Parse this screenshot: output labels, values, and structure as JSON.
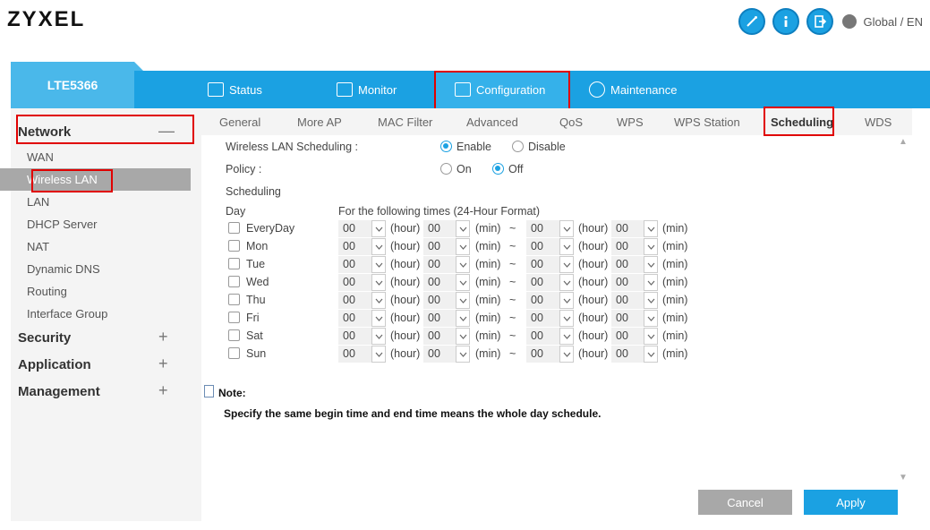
{
  "brand": "ZYXEL",
  "header": {
    "icons": [
      "wizard-icon",
      "info-icon",
      "logout-icon"
    ],
    "language": "Global / EN"
  },
  "device": "LTE5366",
  "nav": [
    {
      "label": "Status",
      "icon": "status-icon"
    },
    {
      "label": "Monitor",
      "icon": "monitor-icon"
    },
    {
      "label": "Configuration",
      "icon": "configuration-icon"
    },
    {
      "label": "Maintenance",
      "icon": "gear-icon"
    }
  ],
  "sidebar": {
    "network": {
      "label": "Network",
      "toggle": "—",
      "items": [
        "WAN",
        "Wireless LAN",
        "LAN",
        "DHCP Server",
        "NAT",
        "Dynamic DNS",
        "Routing",
        "Interface Group"
      ]
    },
    "groups": [
      {
        "label": "Security",
        "toggle": "+"
      },
      {
        "label": "Application",
        "toggle": "+"
      },
      {
        "label": "Management",
        "toggle": "+"
      }
    ]
  },
  "tabs": [
    "General",
    "More AP",
    "MAC Filter",
    "Advanced",
    "QoS",
    "WPS",
    "WPS Station",
    "Scheduling",
    "WDS"
  ],
  "form": {
    "wlan_scheduling_label": "Wireless LAN Scheduling :",
    "enable": "Enable",
    "disable": "Disable",
    "policy_label": "Policy :",
    "on": "On",
    "off": "Off",
    "scheduling_label": "Scheduling",
    "day_header": "Day",
    "times_header": "For the following times (24-Hour Format)",
    "hour_unit": "(hour)",
    "min_unit": "(min)",
    "tilde": "~",
    "rows": [
      {
        "day": "EveryDay",
        "v": [
          "00",
          "00",
          "00",
          "00"
        ]
      },
      {
        "day": "Mon",
        "v": [
          "00",
          "00",
          "00",
          "00"
        ]
      },
      {
        "day": "Tue",
        "v": [
          "00",
          "00",
          "00",
          "00"
        ]
      },
      {
        "day": "Wed",
        "v": [
          "00",
          "00",
          "00",
          "00"
        ]
      },
      {
        "day": "Thu",
        "v": [
          "00",
          "00",
          "00",
          "00"
        ]
      },
      {
        "day": "Fri",
        "v": [
          "00",
          "00",
          "00",
          "00"
        ]
      },
      {
        "day": "Sat",
        "v": [
          "00",
          "00",
          "00",
          "00"
        ]
      },
      {
        "day": "Sun",
        "v": [
          "00",
          "00",
          "00",
          "00"
        ]
      }
    ]
  },
  "note": {
    "title": "Note:",
    "text": "Specify the same begin time and end time means the whole day schedule."
  },
  "buttons": {
    "cancel": "Cancel",
    "apply": "Apply"
  },
  "colors": {
    "accent": "#1ba1e2",
    "highlight": "#e00000"
  }
}
